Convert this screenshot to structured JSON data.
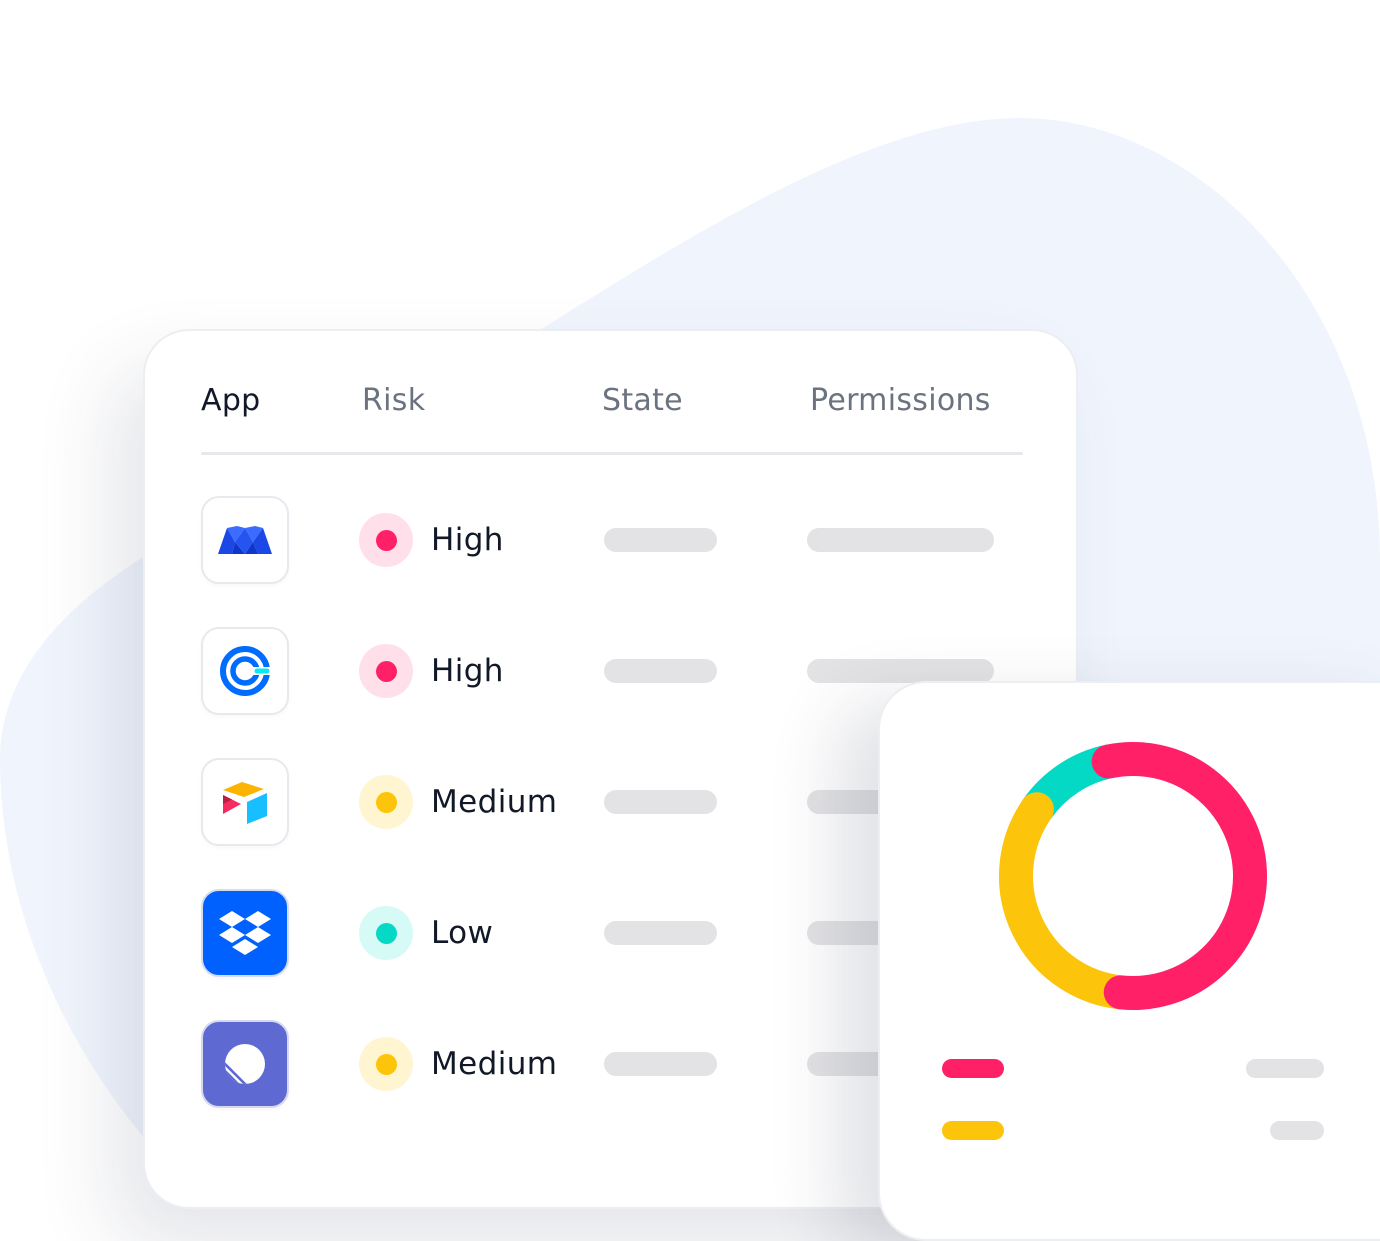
{
  "table": {
    "columns": [
      "App",
      "Risk",
      "State",
      "Permissions"
    ],
    "active_column": "App",
    "rows": [
      {
        "app_icon": "monday-logo-icon",
        "risk": "High",
        "risk_color": "#ff2068",
        "risk_bg": "#ffe0ea"
      },
      {
        "app_icon": "calendly-logo-icon",
        "risk": "High",
        "risk_color": "#ff2068",
        "risk_bg": "#ffe0ea"
      },
      {
        "app_icon": "airtable-logo-icon",
        "risk": "Medium",
        "risk_color": "#fcc40a",
        "risk_bg": "#fff5d1"
      },
      {
        "app_icon": "dropbox-logo-icon",
        "risk": "Low",
        "risk_color": "#03d9c5",
        "risk_bg": "#d6fbf6"
      },
      {
        "app_icon": "linear-logo-icon",
        "risk": "Medium",
        "risk_color": "#fcc40a",
        "risk_bg": "#fff5d1"
      }
    ]
  },
  "chart_data": {
    "type": "pie",
    "categories": [
      "High",
      "Medium",
      "Low"
    ],
    "values": [
      55,
      33,
      12
    ],
    "colors": [
      "#ff2068",
      "#fcc40a",
      "#03d9c5"
    ]
  },
  "legend": [
    {
      "color": "#ff2068"
    },
    {
      "color": "#fcc40a"
    }
  ]
}
